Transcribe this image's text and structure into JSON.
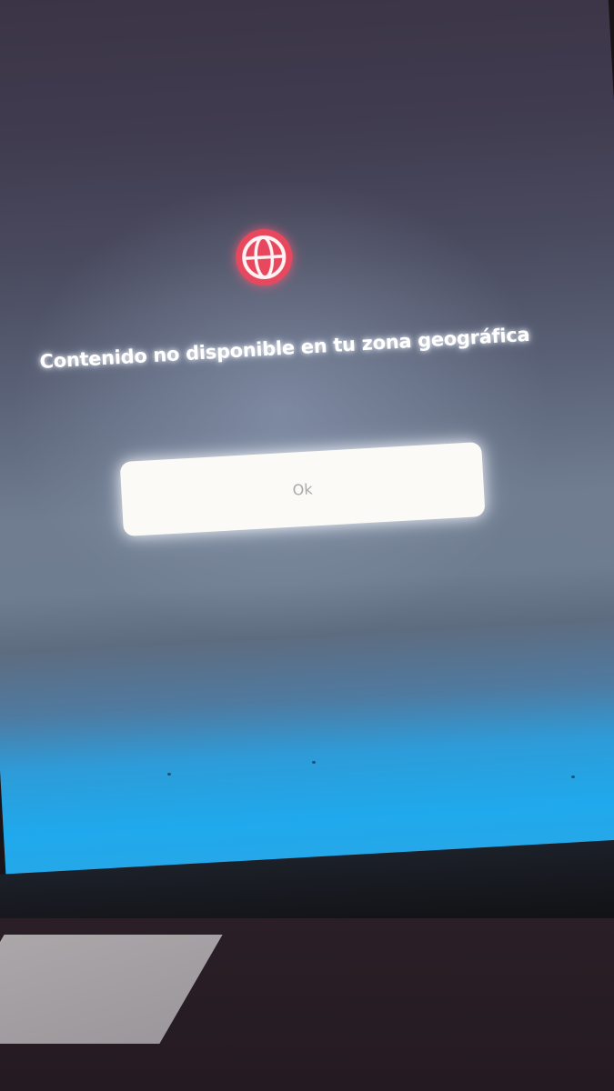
{
  "dialog": {
    "icon": "globe-icon",
    "message": "Contenido no disponible en tu zona geográfica",
    "ok_label": "Ok"
  },
  "colors": {
    "icon_accent": "#e8485e",
    "button_bg": "#fbfaf7",
    "message_text": "#ffffff",
    "screen_blue": "#1fa9ec"
  }
}
